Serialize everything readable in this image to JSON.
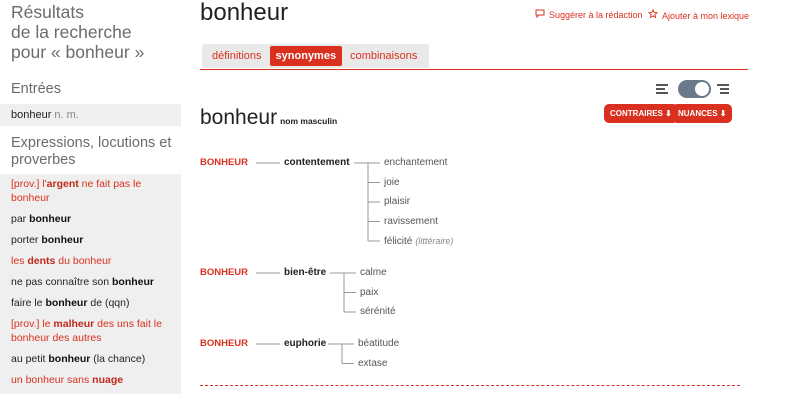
{
  "sidebar": {
    "title": [
      "Résultats",
      "de la recherche",
      "pour « bonheur »"
    ],
    "entries_heading": "Entrées",
    "entry": {
      "word": "bonheur",
      "pos": "n. m."
    },
    "expressions_heading": [
      "Expressions, locutions et",
      "proverbes"
    ],
    "expressions": [
      {
        "red": true,
        "parts": [
          [
            "[prov.] l'",
            false
          ],
          [
            "argent",
            true
          ],
          [
            " ne fait pas le bonheur",
            false
          ]
        ]
      },
      {
        "red": false,
        "parts": [
          [
            "par ",
            false
          ],
          [
            "bonheur",
            true
          ]
        ]
      },
      {
        "red": false,
        "parts": [
          [
            "porter ",
            false
          ],
          [
            "bonheur",
            true
          ]
        ]
      },
      {
        "red": true,
        "parts": [
          [
            "les ",
            false
          ],
          [
            "dents",
            true
          ],
          [
            " du bonheur",
            false
          ]
        ]
      },
      {
        "red": false,
        "parts": [
          [
            "ne pas connaître son ",
            false
          ],
          [
            "bonheur",
            true
          ]
        ]
      },
      {
        "red": false,
        "parts": [
          [
            "faire le ",
            false
          ],
          [
            "bonheur",
            true
          ],
          [
            " de (qqn)",
            false
          ]
        ]
      },
      {
        "red": true,
        "parts": [
          [
            "[prov.] le ",
            false
          ],
          [
            "malheur",
            true
          ],
          [
            " des uns fait le bonheur des autres",
            false
          ]
        ]
      },
      {
        "red": false,
        "parts": [
          [
            "au petit ",
            false
          ],
          [
            "bonheur",
            true
          ],
          [
            " (la chance)",
            false
          ]
        ]
      },
      {
        "red": true,
        "parts": [
          [
            "un bonheur sans ",
            false
          ],
          [
            "nuage",
            true
          ]
        ]
      }
    ]
  },
  "header": {
    "title": "bonheur",
    "suggest_label": "Suggérer à la rédaction",
    "lexicon_label": "Ajouter à mon lexique"
  },
  "tabs": [
    {
      "label": "définitions",
      "active": false
    },
    {
      "label": "synonymes",
      "active": true
    },
    {
      "label": "combinaisons",
      "active": false
    }
  ],
  "word": {
    "text": "bonheur",
    "grammar": "nom masculin"
  },
  "buttons": {
    "contraires": "CONTRAIRES ⬇",
    "nuances": "NUANCES ⬇"
  },
  "groups": [
    {
      "head": "BONHEUR",
      "category": "contentement",
      "synonyms": [
        {
          "text": "enchantement",
          "register": ""
        },
        {
          "text": "joie",
          "register": ""
        },
        {
          "text": "plaisir",
          "register": ""
        },
        {
          "text": "ravissement",
          "register": ""
        },
        {
          "text": "félicité",
          "register": "(littéraire)"
        }
      ]
    },
    {
      "head": "BONHEUR",
      "category": "bien-être",
      "synonyms": [
        {
          "text": "calme",
          "register": ""
        },
        {
          "text": "paix",
          "register": ""
        },
        {
          "text": "sérénité",
          "register": ""
        }
      ]
    },
    {
      "head": "BONHEUR",
      "category": "euphorie",
      "synonyms": [
        {
          "text": "béatitude",
          "register": ""
        },
        {
          "text": "extase",
          "register": ""
        }
      ]
    }
  ],
  "colors": {
    "accent": "#d9301f",
    "toggle": "#6b7a8a",
    "sidebar_bg": "#efefef"
  }
}
